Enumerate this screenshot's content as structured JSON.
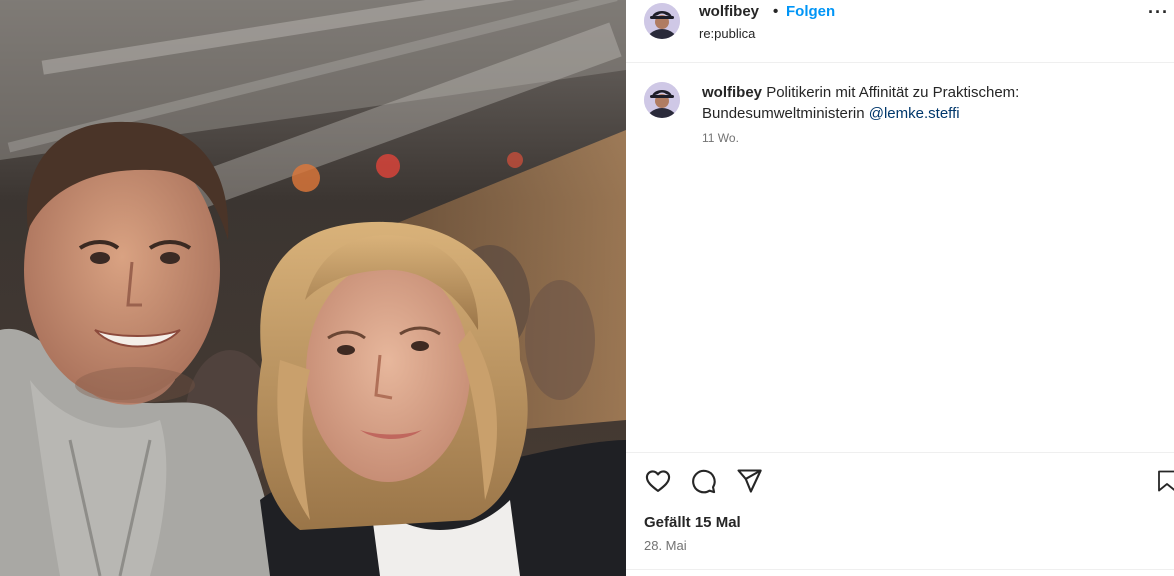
{
  "post": {
    "username": "wolfibey",
    "separator": "•",
    "follow_label": "Folgen",
    "location": "re:publica",
    "more_label": "···"
  },
  "caption": {
    "username": "wolfibey",
    "text": "Politikerin mit Affinität zu Praktischem: Bundesumweltministerin",
    "mention": "@lemke.steffi",
    "time_ago": "11 Wo."
  },
  "actions": {
    "icons": [
      "heart-icon",
      "comment-icon",
      "share-icon",
      "bookmark-icon"
    ]
  },
  "stats": {
    "likes": "Gefällt 15 Mal",
    "date": "28. Mai"
  },
  "colors": {
    "follow": "#0095f6",
    "mention": "#00376b",
    "muted": "#737373",
    "text": "#262626"
  }
}
